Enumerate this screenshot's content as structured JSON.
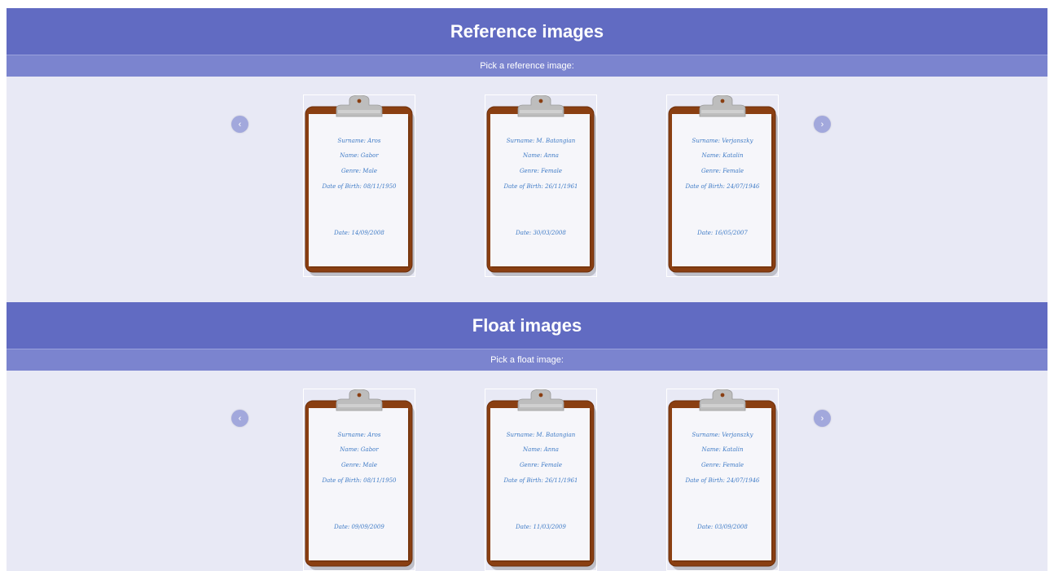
{
  "sections": [
    {
      "title": "Reference images",
      "subtitle": "Pick a reference image:",
      "prev_label": "‹",
      "next_label": "›",
      "cards": [
        {
          "surname": "Surname: Aros",
          "name": "Name: Gabor",
          "genre": "Genre: Male",
          "dob": "Date of Birth: 08/11/1950",
          "date": "Date: 14/09/2008"
        },
        {
          "surname": "Surname: M. Batangian",
          "name": "Name: Anna",
          "genre": "Genre: Female",
          "dob": "Date of Birth: 26/11/1961",
          "date": "Date: 30/03/2008"
        },
        {
          "surname": "Surname: Verjanszky",
          "name": "Name: Katalin",
          "genre": "Genre: Female",
          "dob": "Date of Birth: 24/07/1946",
          "date": "Date: 16/05/2007"
        }
      ]
    },
    {
      "title": "Float images",
      "subtitle": "Pick a float image:",
      "prev_label": "‹",
      "next_label": "›",
      "cards": [
        {
          "surname": "Surname: Aros",
          "name": "Name: Gabor",
          "genre": "Genre: Male",
          "dob": "Date of Birth: 08/11/1950",
          "date": "Date: 09/09/2009"
        },
        {
          "surname": "Surname: M. Batangian",
          "name": "Name: Anna",
          "genre": "Genre: Female",
          "dob": "Date of Birth: 26/11/1961",
          "date": "Date: 11/03/2009"
        },
        {
          "surname": "Surname: Verjanszky",
          "name": "Name: Katalin",
          "genre": "Genre: Female",
          "dob": "Date of Birth: 24/07/1946",
          "date": "Date: 03/09/2008"
        }
      ]
    }
  ],
  "colors": {
    "header": "#616bc2",
    "subheader": "#7b84cf",
    "body": "#e8e9f5",
    "board": "#8a3f12",
    "paper": "#f6f6fa",
    "text": "#3f7bc6"
  },
  "icons": {
    "prev": "chevron-left-icon",
    "next": "chevron-right-icon",
    "card": "clipboard-icon"
  }
}
